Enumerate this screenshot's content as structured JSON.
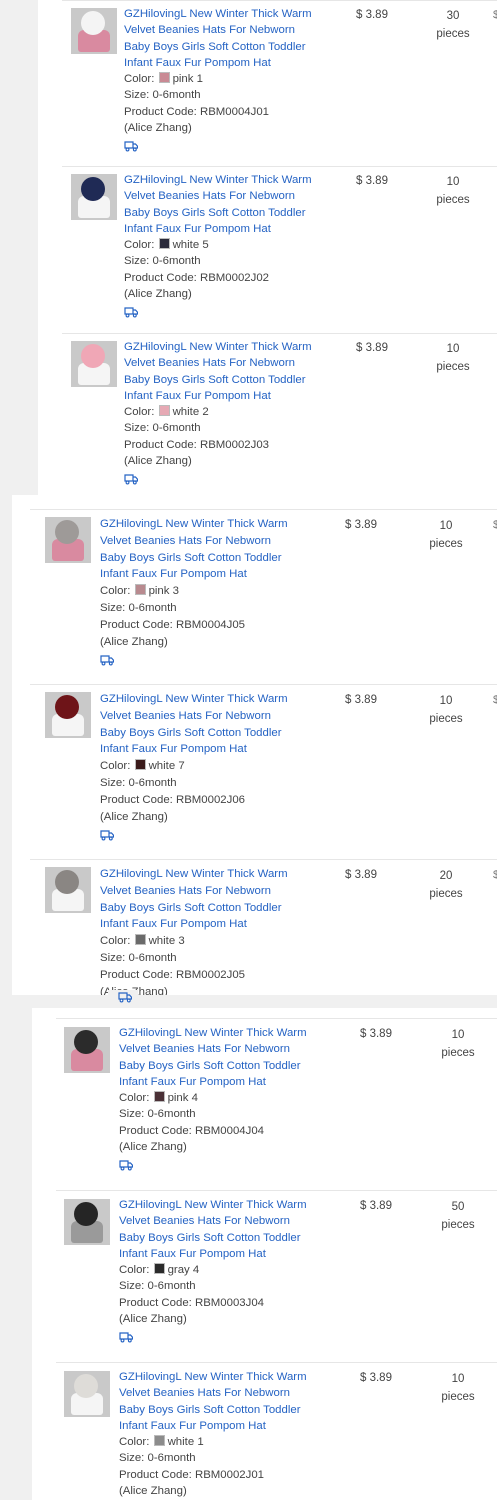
{
  "colors": {
    "link": "#2563c4",
    "text": "#444444",
    "page_bg": "#f0f0f0"
  },
  "orders": [
    {
      "title": "GZHilovingL New Winter Thick Warm Velvet Beanies Hats For Nebworn Baby Boys Girls Soft Cotton Toddler Infant Faux Fur Pompom Hat",
      "color_label": "Color:",
      "color": "pink 1",
      "size": "Size: 0-6month",
      "code": "Product Code: RBM0004J01",
      "seller": "(Alice Zhang)",
      "price": "$ 3.89",
      "qty": "30",
      "unit": "pieces",
      "swatch": "#c98a94",
      "hat": "#d98aa0",
      "pom": "#f4f4f4",
      "icon": "shipping-truck-icon"
    },
    {
      "title": "GZHilovingL New Winter Thick Warm Velvet Beanies Hats For Nebworn Baby Boys Girls Soft Cotton Toddler Infant Faux Fur Pompom Hat",
      "color_label": "Color:",
      "color": "white 5",
      "size": "Size: 0-6month",
      "code": "Product Code: RBM0002J02",
      "seller": "(Alice Zhang)",
      "price": "$ 3.89",
      "qty": "10",
      "unit": "pieces",
      "swatch": "#2a2a3a",
      "hat": "#f5f5f5",
      "pom": "#1f2a55",
      "icon": "shipping-truck-icon"
    },
    {
      "title": "GZHilovingL New Winter Thick Warm Velvet Beanies Hats For Nebworn Baby Boys Girls Soft Cotton Toddler Infant Faux Fur Pompom Hat",
      "color_label": "Color:",
      "color": "white 2",
      "size": "Size: 0-6month",
      "code": "Product Code: RBM0002J03",
      "seller": "(Alice Zhang)",
      "price": "$ 3.89",
      "qty": "10",
      "unit": "pieces",
      "swatch": "#e6a9b4",
      "hat": "#f5f5f5",
      "pom": "#f0a7b6",
      "icon": "shipping-truck-icon"
    },
    {
      "title": "GZHilovingL New Winter Thick Warm Velvet Beanies Hats For Nebworn Baby Boys Girls Soft Cotton Toddler Infant Faux Fur Pompom Hat",
      "color_label": "Color:",
      "color": "pink 3",
      "size": "Size: 0-6month",
      "code": "Product Code: RBM0004J05",
      "seller": "(Alice Zhang)",
      "price": "$ 3.89",
      "qty": "10",
      "unit": "pieces",
      "swatch": "#b88a8f",
      "hat": "#d98aa0",
      "pom": "#9e9a98",
      "icon": "shipping-truck-icon"
    },
    {
      "title": "GZHilovingL New Winter Thick Warm Velvet Beanies Hats For Nebworn Baby Boys Girls Soft Cotton Toddler Infant Faux Fur Pompom Hat",
      "color_label": "Color:",
      "color": "white 7",
      "size": "Size: 0-6month",
      "code": "Product Code: RBM0002J06",
      "seller": "(Alice Zhang)",
      "price": "$ 3.89",
      "qty": "10",
      "unit": "pieces",
      "swatch": "#3a1a1a",
      "hat": "#f5f5f5",
      "pom": "#6e1418",
      "icon": "shipping-truck-icon"
    },
    {
      "title": "GZHilovingL New Winter Thick Warm Velvet Beanies Hats For Nebworn Baby Boys Girls Soft Cotton Toddler Infant Faux Fur Pompom Hat",
      "color_label": "Color:",
      "color": "white 3",
      "size": "Size: 0-6month",
      "code": "Product Code: RBM0002J05",
      "seller": "(Alice Zhang)",
      "price": "$ 3.89",
      "qty": "20",
      "unit": "pieces",
      "swatch": "#6a6a6a",
      "hat": "#f5f5f5",
      "pom": "#8a8683",
      "icon": "shipping-truck-icon"
    },
    {
      "title": "GZHilovingL New Winter Thick Warm Velvet Beanies Hats For Nebworn Baby Boys Girls Soft Cotton Toddler Infant Faux Fur Pompom Hat",
      "color_label": "Color:",
      "color": "pink 4",
      "size": "Size: 0-6month",
      "code": "Product Code: RBM0004J04",
      "seller": "(Alice Zhang)",
      "price": "$ 3.89",
      "qty": "10",
      "unit": "pieces",
      "swatch": "#4a3036",
      "hat": "#d98aa0",
      "pom": "#2b2b2b",
      "icon": "shipping-truck-icon"
    },
    {
      "title": "GZHilovingL New Winter Thick Warm Velvet Beanies Hats For Nebworn Baby Boys Girls Soft Cotton Toddler Infant Faux Fur Pompom Hat",
      "color_label": "Color:",
      "color": "gray 4",
      "size": "Size: 0-6month",
      "code": "Product Code: RBM0003J04",
      "seller": "(Alice Zhang)",
      "price": "$ 3.89",
      "qty": "50",
      "unit": "pieces",
      "swatch": "#2b2b2b",
      "hat": "#9a9a9a",
      "pom": "#252525",
      "icon": "shipping-truck-icon"
    },
    {
      "title": "GZHilovingL New Winter Thick Warm Velvet Beanies Hats For Nebworn Baby Boys Girls Soft Cotton Toddler Infant Faux Fur Pompom Hat",
      "color_label": "Color:",
      "color": "white 1",
      "size": "Size: 0-6month",
      "code": "Product Code: RBM0002J01",
      "seller": "(Alice Zhang)",
      "price": "$ 3.89",
      "qty": "10",
      "unit": "pieces",
      "swatch": "#8c8c8c",
      "hat": "#f5f5f5",
      "pom": "#dedcd8",
      "icon": "shipping-truck-icon"
    }
  ],
  "edge_glyph": "$"
}
